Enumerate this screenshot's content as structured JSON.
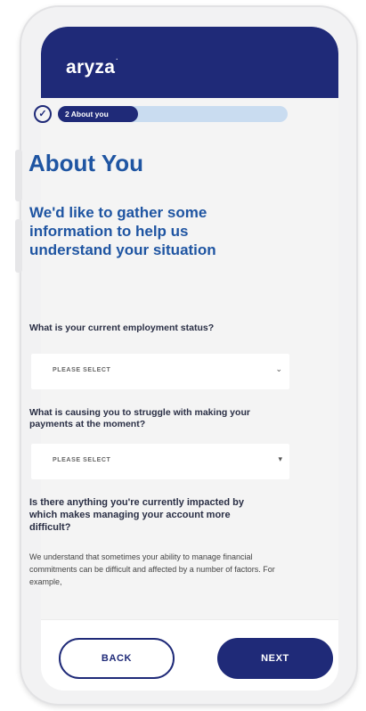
{
  "app": {
    "logo": "aryza",
    "logo_mark": "·"
  },
  "progress": {
    "step_label": "2 About you",
    "fraction": 0.35
  },
  "page": {
    "title": "About You",
    "intro": "We'd like to gather some information to help us understand your situation"
  },
  "questions": [
    {
      "label": "What is your current employment status?",
      "placeholder": "PLEASE SELECT"
    },
    {
      "label": "What is causing you to struggle with making your payments at the moment?",
      "placeholder": "PLEASE SELECT"
    },
    {
      "label": "Is there anything you're currently impacted by which makes managing your account more difficult?"
    }
  ],
  "description": "We understand that sometimes your ability to manage financial commitments can be difficult and affected by a number of factors. For example,",
  "buttons": {
    "back": "BACK",
    "next": "NEXT"
  },
  "colors": {
    "brand_navy": "#1f2a78",
    "heading_blue": "#1f55a2",
    "progress_track": "#c9dcf0"
  },
  "icons": {
    "step_complete": "check-circle-icon",
    "select_arrow": "chevron-down-icon"
  }
}
